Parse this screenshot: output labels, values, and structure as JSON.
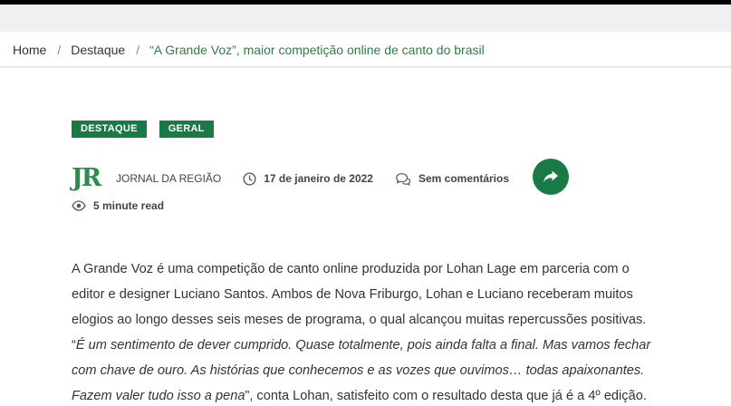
{
  "breadcrumb": {
    "home": "Home",
    "section": "Destaque",
    "current": "“A Grande Voz”, maior competição online de canto do brasil",
    "separator": "/"
  },
  "categories": [
    "DESTAQUE",
    "GERAL"
  ],
  "meta": {
    "logo_text": "JR",
    "author": "JORNAL DA REGIÃO",
    "date": "17 de janeiro de 2022",
    "comments": "Sem comentários",
    "read_time": "5 minute read"
  },
  "article": {
    "lines": [
      "A Grande Voz é uma competição de canto online produzida por Lohan Lage em parceria com o",
      "editor e designer Luciano Santos. Ambos de Nova Friburgo, Lohan e Luciano receberam muitos",
      "elogios ao longo desses seis meses de programa, o qual alcançou muitas repercussões positivas."
    ],
    "quote_open": "“",
    "quote_line1": "É um sentimento de dever cumprido. Quase totalmente, pois ainda falta a final. Mas vamos fechar",
    "quote_line2": "com chave de ouro. As histórias que conhecemos e as vozes que ouvimos… todas apaixonantes.",
    "quote_line3": "Fazem valer tudo isso a pena",
    "quote_tail": "”, conta Lohan, satisfeito com o resultado desta que já é a 4º edição."
  },
  "colors": {
    "brand_green": "#1a7a45",
    "link_green": "#2e7d46",
    "top_bar": "#000000",
    "gray_bar": "#f0f0f2"
  },
  "icons": [
    "clock-icon",
    "comments-icon",
    "share-icon",
    "eye-icon"
  ]
}
